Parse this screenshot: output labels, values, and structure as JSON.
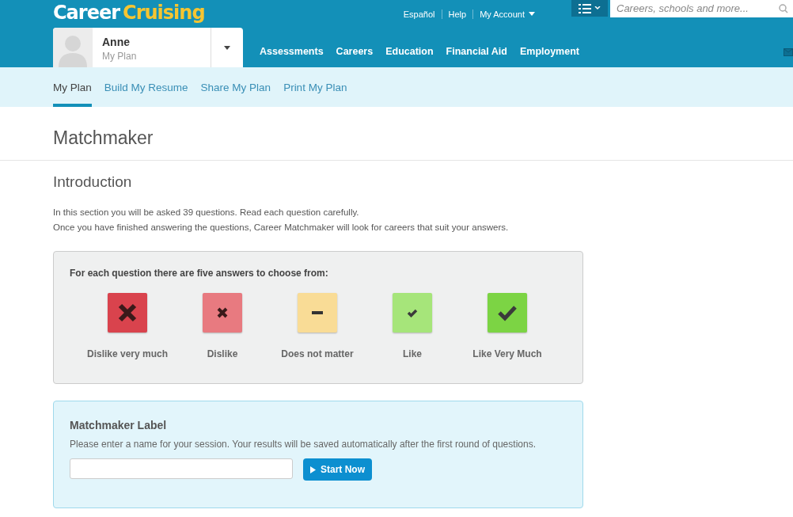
{
  "header": {
    "logo": {
      "part_1": "Career",
      "part_2": "Cruising"
    },
    "top_links": [
      "Español",
      "Help",
      "My Account"
    ],
    "search": {
      "placeholder": "Careers, schools and more..."
    },
    "user": {
      "name": "Anne",
      "subtitle": "My Plan"
    },
    "nav": [
      "Assessments",
      "Careers",
      "Education",
      "Financial Aid",
      "Employment"
    ]
  },
  "subnav": [
    {
      "label": "My Plan",
      "selected": true
    },
    {
      "label": "Build My Resume",
      "selected": false
    },
    {
      "label": "Share My Plan",
      "selected": false
    },
    {
      "label": "Print My Plan",
      "selected": false
    }
  ],
  "page_title": "Matchmaker",
  "section_title": "Introduction",
  "intro": [
    "In this section you will be asked 39 questions. Read each question carefully.",
    "Once you have finished answering the questions, Career Matchmaker will look for careers that suit your answers."
  ],
  "answers_panel": {
    "heading": "For each question there are five answers to choose from:",
    "answers": [
      {
        "kind": "cross-large",
        "label": "Dislike very much",
        "color": "#d9434d"
      },
      {
        "kind": "cross-small",
        "label": "Dislike",
        "color": "#e87a80"
      },
      {
        "kind": "dash",
        "label": "Does not matter",
        "color": "#f9dc96"
      },
      {
        "kind": "check-small",
        "label": "Like",
        "color": "#a6e57a"
      },
      {
        "kind": "check-large",
        "label": "Like Very Much",
        "color": "#7cd444"
      }
    ]
  },
  "label_panel": {
    "heading": "Matchmaker Label",
    "text": "Please enter a name for your session. Your results will be saved automatically after the first round of questions.",
    "button": "Start Now"
  }
}
